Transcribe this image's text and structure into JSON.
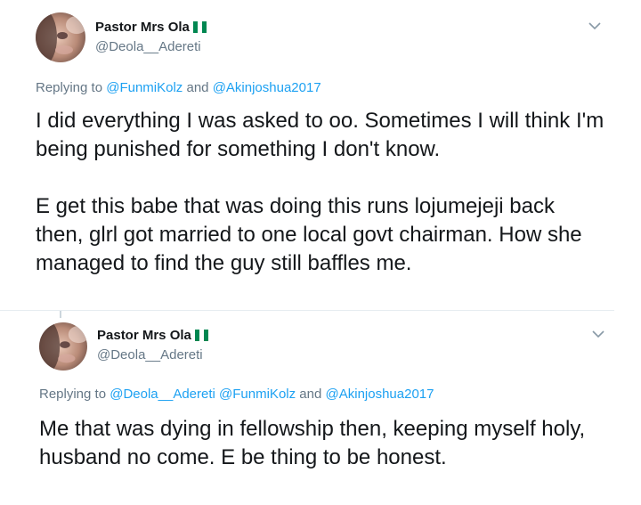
{
  "tweets": [
    {
      "author_name": "Pastor Mrs Ola",
      "flag_icon": "nigeria-flag-icon",
      "handle": "@Deola__Adereti",
      "replying_prefix": "Replying to",
      "mentions": [
        "@FunmiKolz",
        "@Akinjoshua2017"
      ],
      "connector_and": "and",
      "paragraphs": [
        "I did everything I was asked to oo. Sometimes I will think I'm being punished for something I don't know.",
        "E get this babe that was doing this runs lojumejeji back then, glrl got married to one local govt chairman. How she managed to find the guy still baffles me."
      ]
    },
    {
      "author_name": "Pastor Mrs Ola",
      "flag_icon": "nigeria-flag-icon",
      "handle": "@Deola__Adereti",
      "replying_prefix": "Replying to",
      "mentions": [
        "@Deola__Adereti",
        "@FunmiKolz",
        "@Akinjoshua2017"
      ],
      "connector_and": "and",
      "paragraphs": [
        "Me that was dying in fellowship then, keeping myself holy, husband no come. E be thing to be honest."
      ]
    }
  ],
  "colors": {
    "text": "#14171a",
    "secondary": "#657786",
    "link": "#1da1f2",
    "divider": "#e6ecf0",
    "flag_green": "#008751"
  }
}
